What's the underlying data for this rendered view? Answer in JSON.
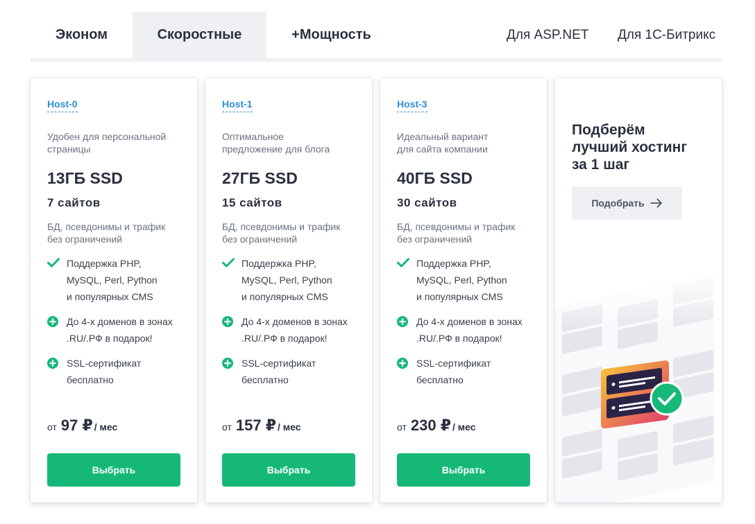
{
  "tabs": {
    "items": [
      "Эконом",
      "Скоростные",
      "+Мощность"
    ],
    "right": [
      "Для ASP.NET",
      "Для 1С-Битрикс"
    ]
  },
  "plans": [
    {
      "name": "Host-0",
      "desc_line1": "Удобен для персональной",
      "desc_line2": "страницы",
      "disk": "13ГБ SSD",
      "sites": "7 сайтов",
      "limits_line1": "БД, псевдонимы и трафик",
      "limits_line2": "без ограничений",
      "features": [
        {
          "l1": "Поддержка PHP,",
          "l2": "MySQL, Perl, Python",
          "l3": "и популярных CMS"
        },
        {
          "l1": "До 4-х доменов в зонах",
          "l2": ".RU/.РФ в подарок!"
        },
        {
          "l1": "SSL-сертификат",
          "l2": "бесплатно"
        }
      ],
      "price_from": "от",
      "price": "97 ₽",
      "price_per": "/ мес",
      "button": "Выбрать"
    },
    {
      "name": "Host-1",
      "desc_line1": "Оптимальное",
      "desc_line2": "предложение для блога",
      "disk": "27ГБ SSD",
      "sites": "15 сайтов",
      "limits_line1": "БД, псевдонимы и трафик",
      "limits_line2": "без ограничений",
      "features": [
        {
          "l1": "Поддержка PHP,",
          "l2": "MySQL, Perl, Python",
          "l3": "и популярных CMS"
        },
        {
          "l1": "До 4-х доменов в зонах",
          "l2": ".RU/.РФ в подарок!"
        },
        {
          "l1": "SSL-сертификат",
          "l2": "бесплатно"
        }
      ],
      "price_from": "от",
      "price": "157 ₽",
      "price_per": "/ мес",
      "button": "Выбрать"
    },
    {
      "name": "Host-3",
      "desc_line1": "Идеальный вариант",
      "desc_line2": "для сайта компании",
      "disk": "40ГБ SSD",
      "sites": "30 сайтов",
      "limits_line1": "БД, псевдонимы и трафик",
      "limits_line2": "без ограничений",
      "features": [
        {
          "l1": "Поддержка PHP,",
          "l2": "MySQL, Perl, Python",
          "l3": "и популярных CMS"
        },
        {
          "l1": "До 4-х доменов в зонах",
          "l2": ".RU/.РФ в подарок!"
        },
        {
          "l1": "SSL-сертификат",
          "l2": "бесплатно"
        }
      ],
      "price_from": "от",
      "price": "230 ₽",
      "price_per": "/ мес",
      "button": "Выбрать"
    }
  ],
  "promo": {
    "title_line1": "Подберём",
    "title_line2": "лучший хостинг",
    "title_line3": "за 1 шаг",
    "button": "Подобрать"
  },
  "icons": {
    "feature1": "check-icon",
    "feature2": "plus-circle-icon",
    "feature3": "plus-circle-icon",
    "promo_button": "arrow-right-icon"
  },
  "colors": {
    "accent_green": "#16b878",
    "link_blue": "#2a8fd6",
    "tab_active_bg": "#eef0f4",
    "text_dark": "#2b3040"
  }
}
